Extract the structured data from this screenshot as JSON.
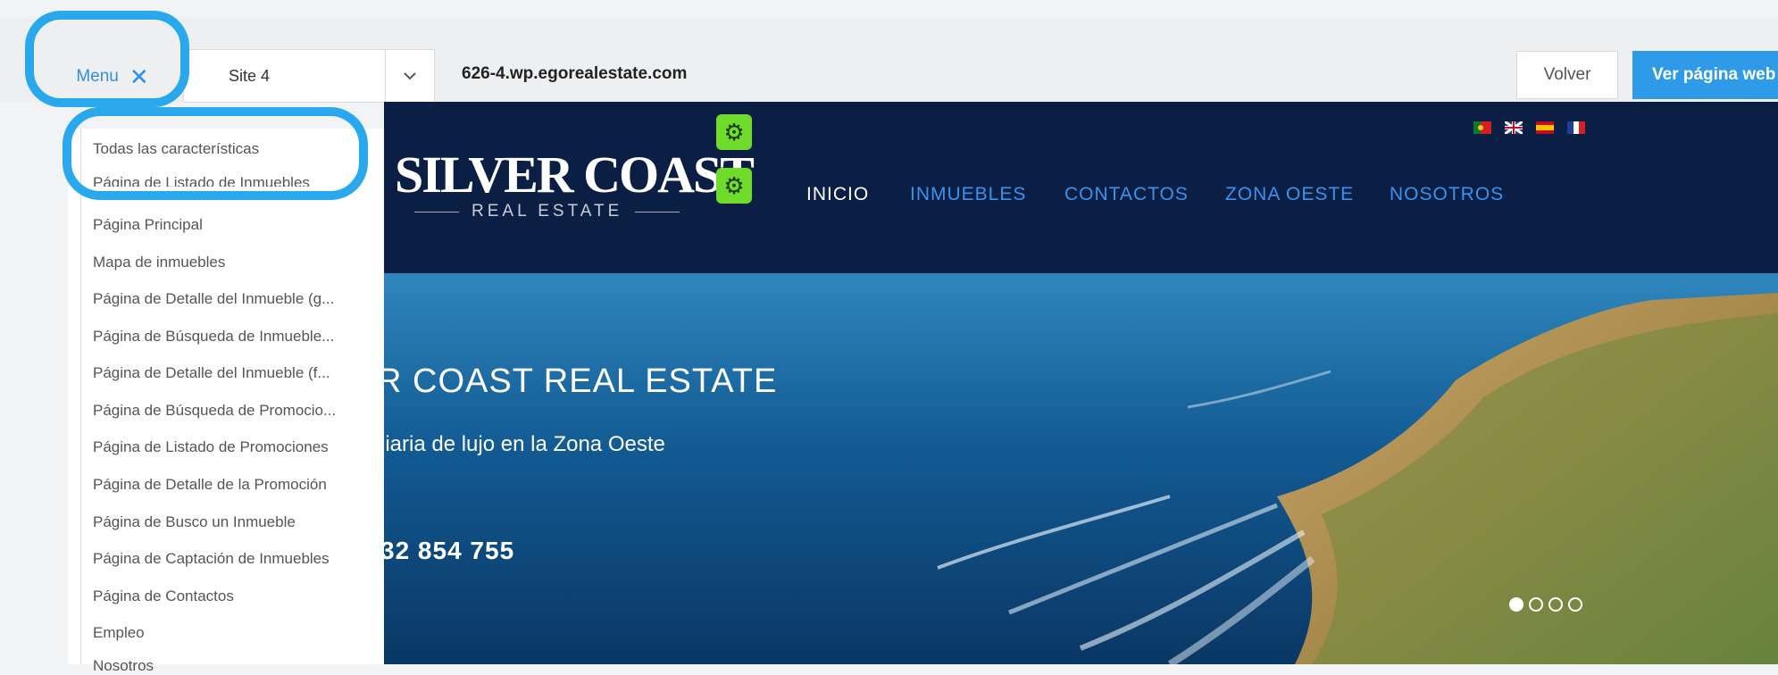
{
  "toolbar": {
    "menu_label": "Menu",
    "close_glyph": "✕",
    "site_select_value": "Site 4",
    "domain": "626-4.wp.egorealestate.com",
    "back_label": "Volver",
    "view_site_label": "Ver página web"
  },
  "menu": {
    "items": [
      "Todas las características",
      "Página de Listado de Inmuebles",
      "Página Principal",
      "Mapa de inmuebles",
      "Página de Detalle del Inmueble (g...",
      "Página de Búsqueda de Inmueble...",
      "Página de Detalle del Inmueble (f...",
      "Página de Búsqueda de Promocio...",
      "Página de Listado de Promociones",
      "Página de Detalle de la Promoción",
      "Página de Busco un Inmueble",
      "Página de Captación de Inmuebles",
      "Página de Contactos",
      "Empleo",
      "Nosotros"
    ]
  },
  "site": {
    "logo_title": "SILVER COAST",
    "logo_subtitle": "REAL ESTATE",
    "nav": [
      "INICIO",
      "INMUEBLES",
      "CONTACTOS",
      "ZONA OESTE",
      "NOSOTROS"
    ],
    "hero_title": "R COAST REAL ESTATE",
    "hero_subtitle": "liaria de lujo en la Zona Oeste",
    "hero_phone": "32 854 755",
    "slider_dots": 4,
    "active_dot": 1
  },
  "colors": {
    "accent": "#2aa8ee",
    "header_bg": "#0b1f45",
    "nav_link": "#3b92ee",
    "gear": "#6fdc2c"
  },
  "icons": [
    "close-icon",
    "chevron-down-icon",
    "gear-icon",
    "flag-portugal-icon",
    "flag-uk-icon",
    "flag-spain-icon",
    "flag-france-icon"
  ]
}
